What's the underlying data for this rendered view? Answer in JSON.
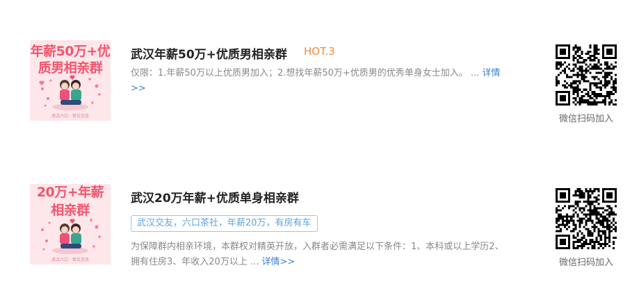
{
  "groups": [
    {
      "thumb_title_line1": "年薪50万+优",
      "thumb_title_line2": "质男相亲群",
      "thumb_footer": "武汉六口 · 单位交流",
      "title": "武汉年薪50万+优质男相亲群",
      "hot": "HOT.3",
      "desc": "仅限：1.年薪50万以上优质男加入；2.想找年薪50万+优质男的优秀单身女士加入。 ...",
      "more": "详情>>",
      "qr_caption": "微信扫码加入"
    },
    {
      "thumb_title_line1": "20万+年薪",
      "thumb_title_line2": "相亲群",
      "thumb_footer": "武汉六口 · 单位交流",
      "title": "武汉20万年薪+优质单身相亲群",
      "tags": "武汉交友，六口茶社，年薪20万，有房有车",
      "desc": "为保障群内相亲环境，本群权对精英开放，入群者必需满足以下条件：1、本科或以上学历2、拥有住房3、年收入20万以上 ...",
      "more": "详情>>",
      "qr_caption": "微信扫码加入"
    }
  ]
}
